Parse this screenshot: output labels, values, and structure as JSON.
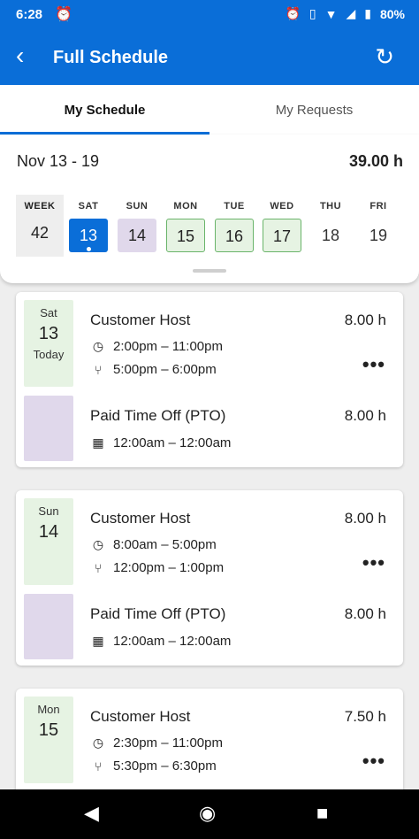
{
  "status_bar": {
    "time": "6:28",
    "battery": "80%",
    "icons": [
      "alarm-icon",
      "vibrate-icon",
      "wifi-icon",
      "signal-icon",
      "battery-icon"
    ]
  },
  "app_bar": {
    "title": "Full Schedule",
    "back_icon": "back-chevron-icon",
    "refresh_icon": "refresh-icon",
    "color": "#0a6ed8"
  },
  "tabs": [
    {
      "label": "My Schedule",
      "active": true
    },
    {
      "label": "My Requests",
      "active": false
    }
  ],
  "week": {
    "range": "Nov 13 - 19",
    "total_hours": "39.00 h",
    "week_label": "WEEK",
    "week_number": "42",
    "days": [
      {
        "dow": "SAT",
        "num": "13",
        "state": "selected"
      },
      {
        "dow": "SUN",
        "num": "14",
        "state": "pto"
      },
      {
        "dow": "MON",
        "num": "15",
        "state": "scheduled"
      },
      {
        "dow": "TUE",
        "num": "16",
        "state": "scheduled"
      },
      {
        "dow": "WED",
        "num": "17",
        "state": "scheduled"
      },
      {
        "dow": "THU",
        "num": "18",
        "state": "plain"
      },
      {
        "dow": "FRI",
        "num": "19",
        "state": "plain"
      }
    ]
  },
  "cards": [
    {
      "dow": "Sat",
      "num": "13",
      "today": "Today",
      "shift": {
        "title": "Customer Host",
        "hours": "8.00 h",
        "time": "2:00pm – 11:00pm",
        "meal": "5:00pm – 6:00pm"
      },
      "pto": {
        "title": "Paid Time Off (PTO)",
        "hours": "8.00 h",
        "time": "12:00am – 12:00am"
      }
    },
    {
      "dow": "Sun",
      "num": "14",
      "shift": {
        "title": "Customer Host",
        "hours": "8.00 h",
        "time": "8:00am – 5:00pm",
        "meal": "12:00pm – 1:00pm"
      },
      "pto": {
        "title": "Paid Time Off (PTO)",
        "hours": "8.00 h",
        "time": "12:00am – 12:00am"
      }
    },
    {
      "dow": "Mon",
      "num": "15",
      "shift": {
        "title": "Customer Host",
        "hours": "7.50 h",
        "time": "2:30pm – 11:00pm",
        "meal": "5:30pm – 6:30pm"
      }
    }
  ]
}
